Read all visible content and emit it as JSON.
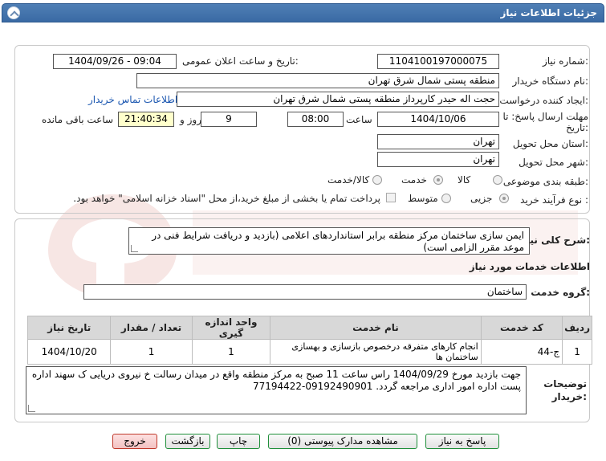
{
  "header": {
    "title": "جزئیات اطلاعات نیاز"
  },
  "form": {
    "need_number_label": "شماره نیاز:",
    "need_number": "1104100197000075",
    "announce_label": "تاریخ و ساعت اعلان عمومی:",
    "announce_value": "1404/09/26 - 09:04",
    "buyer_org_label": "نام دستگاه خریدار:",
    "buyer_org": "منطقه پستی شمال شرق تهران",
    "creator_label": "ایجاد کننده درخواست:",
    "creator": "حجت اله حیدر کارپرداز منطقه پستی شمال شرق تهران",
    "contact_link": "اطلاعات تماس خریدار",
    "deadline_label_1": "مهلت ارسال پاسخ: تا",
    "deadline_label_2": "تاریخ:",
    "deadline_date": "1404/10/06",
    "time_label": "ساعت",
    "deadline_time": "08:00",
    "days_value": "9",
    "days_label": "روز و",
    "remaining_time": "21:40:34",
    "remaining_label": "ساعت باقی مانده",
    "province_label": "استان محل تحویل:",
    "province": "تهران",
    "city_label": "شهر محل تحویل:",
    "city": "تهران",
    "category_label": "طبقه بندی موضوعی:",
    "category_options": [
      "کالا",
      "خدمت",
      "کالا/خدمت"
    ],
    "category_selected": "خدمت",
    "process_label": "نوع فرآیند خرید :",
    "process_options": [
      "جزیی",
      "متوسط"
    ],
    "process_selected": "جزیی",
    "payment_note": "پرداخت تمام یا بخشی از مبلغ خرید،از محل \"اسناد خزانه اسلامی\" خواهد بود."
  },
  "details": {
    "summary_label": "شرح کلی نیاز:",
    "summary": "ایمن سازی ساختمان مرکز منطقه برابر استانداردهای اعلامی (بازدید و دریافت شرایط فنی در موعد مقرر الزامی است)",
    "services_info_title": "اطلاعات خدمات مورد نیاز",
    "service_group_label": "گروه خدمت:",
    "service_group": "ساختمان",
    "table": {
      "headers": [
        "ردیف",
        "کد خدمت",
        "نام خدمت",
        "واحد اندازه گیری",
        "تعداد / مقدار",
        "تاریخ نیاز"
      ],
      "rows": [
        [
          "1",
          "ج-44",
          "انجام کارهای متفرقه درخصوص بازسازی و بهسازی ساختمان ها",
          "1",
          "1",
          "1404/10/20"
        ]
      ]
    },
    "buyer_notes_label_1": "توضیحات",
    "buyer_notes_label_2": "خریدار:",
    "buyer_notes": "جهت بازدید مورخ 1404/09/29 راس ساعت 11 صبح به مرکز منطقه واقع در میدان رسالت خ نیروی دریایی ک سهند اداره پست اداره امور اداری مراجعه گردد. 09192490901-77194422"
  },
  "buttons": {
    "reply": "پاسخ به نیاز",
    "attachments": "مشاهده مدارک پیوستی (0)",
    "print": "چاپ",
    "back": "بازگشت",
    "exit": "خروج"
  },
  "colors": {
    "header": "#3a6aa4",
    "button_border": "#1f8f3a",
    "exit_button": "#f3c2c2"
  }
}
